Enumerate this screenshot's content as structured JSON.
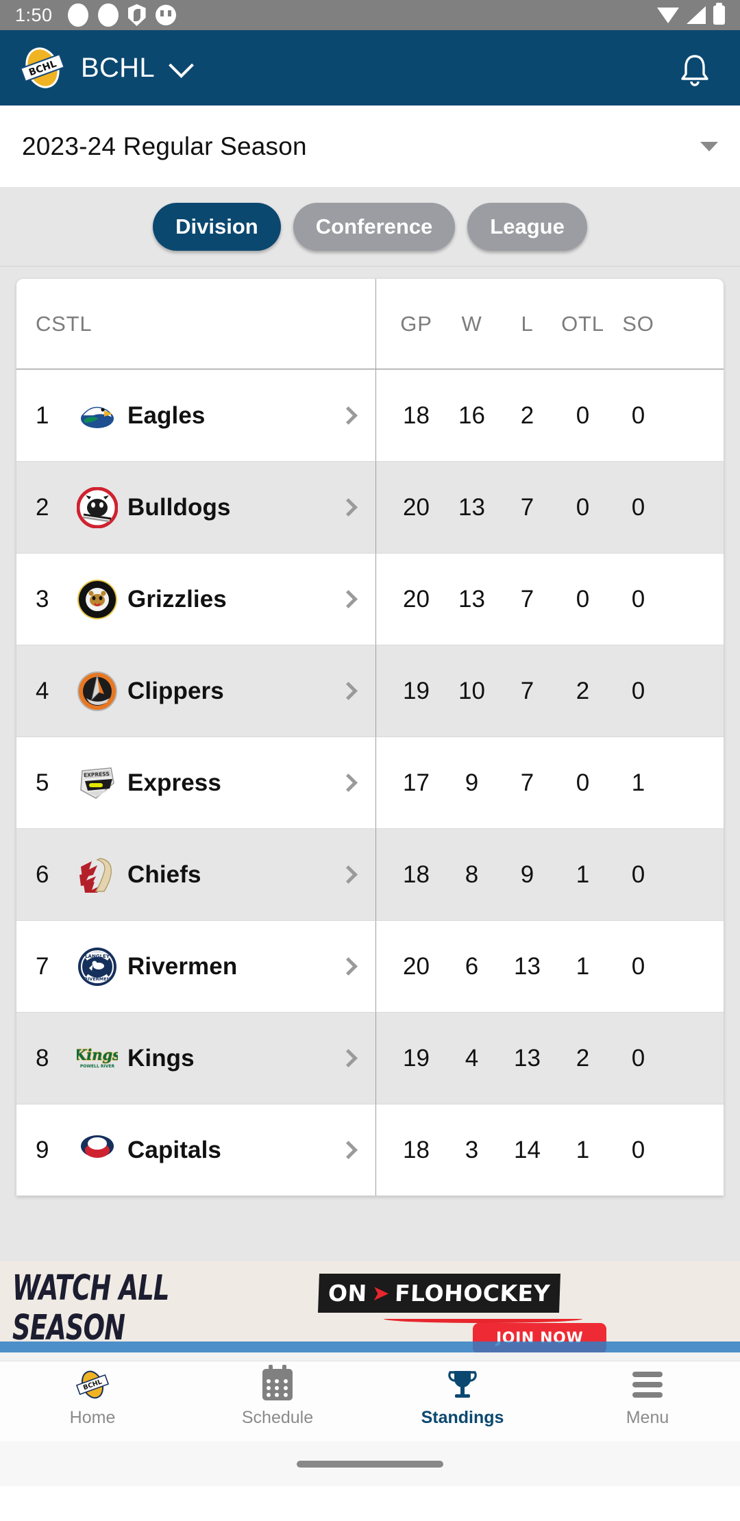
{
  "status_bar": {
    "clock": "1:50",
    "left_icons": [
      "dot-icon",
      "dot-icon",
      "shield-icon",
      "cat-icon"
    ],
    "right_icons": [
      "wifi-icon",
      "signal-icon",
      "battery-icon"
    ]
  },
  "app_bar": {
    "logo": "bchl-logo",
    "title": "BCHL",
    "dropdown_icon": "chevron-down-icon",
    "notification_icon": "bell-icon"
  },
  "season_selector": {
    "value": "2023-24 Regular Season",
    "caret_icon": "caret-down-icon"
  },
  "scope_tabs": [
    {
      "label": "Division",
      "active": true
    },
    {
      "label": "Conference",
      "active": false
    },
    {
      "label": "League",
      "active": false
    }
  ],
  "standings": {
    "type": "table",
    "columns": [
      "CSTL",
      "GP",
      "W",
      "L",
      "OTL",
      "SO"
    ],
    "rows": [
      {
        "rank": "1",
        "team": "Eagles",
        "logo": "surrey-eagles-logo",
        "gp": "18",
        "w": "16",
        "l": "2",
        "otl": "0",
        "so": "0"
      },
      {
        "rank": "2",
        "team": "Bulldogs",
        "logo": "alberni-valley-bulldogs-logo",
        "gp": "20",
        "w": "13",
        "l": "7",
        "otl": "0",
        "so": "0"
      },
      {
        "rank": "3",
        "team": "Grizzlies",
        "logo": "victoria-grizzlies-logo",
        "gp": "20",
        "w": "13",
        "l": "7",
        "otl": "0",
        "so": "0"
      },
      {
        "rank": "4",
        "team": "Clippers",
        "logo": "nanaimo-clippers-logo",
        "gp": "19",
        "w": "10",
        "l": "7",
        "otl": "2",
        "so": "0"
      },
      {
        "rank": "5",
        "team": "Express",
        "logo": "coquitlam-express-logo",
        "gp": "17",
        "w": "9",
        "l": "7",
        "otl": "0",
        "so": "1"
      },
      {
        "rank": "6",
        "team": "Chiefs",
        "logo": "chilliwack-chiefs-logo",
        "gp": "18",
        "w": "8",
        "l": "9",
        "otl": "1",
        "so": "0"
      },
      {
        "rank": "7",
        "team": "Rivermen",
        "logo": "langley-rivermen-logo",
        "gp": "20",
        "w": "6",
        "l": "13",
        "otl": "1",
        "so": "0"
      },
      {
        "rank": "8",
        "team": "Kings",
        "logo": "powell-river-kings-logo",
        "gp": "19",
        "w": "4",
        "l": "13",
        "otl": "2",
        "so": "0"
      },
      {
        "rank": "9",
        "team": "Capitals",
        "logo": "cowichan-valley-capitals-logo",
        "gp": "18",
        "w": "3",
        "l": "14",
        "otl": "1",
        "so": "0"
      }
    ],
    "row_chevron_icon": "chevron-right-icon"
  },
  "advertisement": {
    "headline_line1": "WATCH ALL",
    "headline_line2": "SEASON",
    "brand_prefix": "ON",
    "brand_mark": "flo-tick-icon",
    "brand_name": "FLOHOCKEY",
    "cta_label": "JOIN NOW"
  },
  "bottom_nav": [
    {
      "label": "Home",
      "icon": "bchl-logo-icon",
      "active": false
    },
    {
      "label": "Schedule",
      "icon": "calendar-icon",
      "active": false
    },
    {
      "label": "Standings",
      "icon": "trophy-icon",
      "active": true
    },
    {
      "label": "Menu",
      "icon": "hamburger-icon",
      "active": false
    }
  ],
  "colors": {
    "brand_navy": "#0b4870",
    "brand_gold": "#f0b323",
    "inactive_pill": "#9b9da2",
    "ad_red": "#ee2b35",
    "status_bar": "#808080"
  }
}
